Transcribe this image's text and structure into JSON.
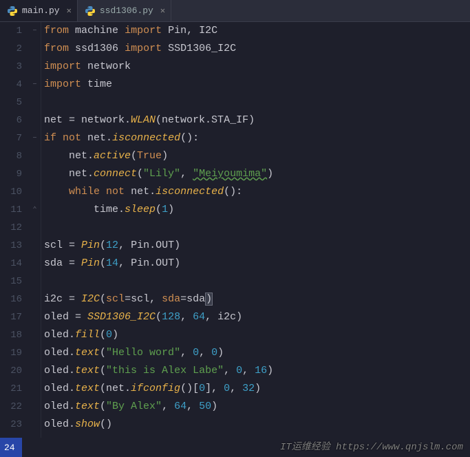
{
  "tabs": [
    {
      "name": "main.py",
      "active": true
    },
    {
      "name": "ssd1306.py",
      "active": false
    }
  ],
  "gutter_start": 1,
  "gutter_end": 23,
  "fold_markers": {
    "1": "−",
    "4": "−",
    "7": "−",
    "11": "⌃"
  },
  "code_lines": [
    [
      [
        "kw",
        "from"
      ],
      [
        "op",
        " "
      ],
      [
        "mod",
        "machine"
      ],
      [
        "op",
        " "
      ],
      [
        "kw",
        "import"
      ],
      [
        "op",
        " "
      ],
      [
        "cls",
        "Pin"
      ],
      [
        "op",
        ", "
      ],
      [
        "cls",
        "I2C"
      ]
    ],
    [
      [
        "kw",
        "from"
      ],
      [
        "op",
        " "
      ],
      [
        "mod",
        "ssd1306"
      ],
      [
        "op",
        " "
      ],
      [
        "kw",
        "import"
      ],
      [
        "op",
        " "
      ],
      [
        "cls",
        "SSD1306_I2C"
      ]
    ],
    [
      [
        "kw",
        "import"
      ],
      [
        "op",
        " "
      ],
      [
        "mod",
        "network"
      ]
    ],
    [
      [
        "kw",
        "import"
      ],
      [
        "op",
        " "
      ],
      [
        "mod",
        "time"
      ]
    ],
    [],
    [
      [
        "op",
        "net = network."
      ],
      [
        "fn",
        "WLAN"
      ],
      [
        "op",
        "(network.STA_IF)"
      ]
    ],
    [
      [
        "kw",
        "if"
      ],
      [
        "op",
        " "
      ],
      [
        "kw",
        "not"
      ],
      [
        "op",
        " net."
      ],
      [
        "fn",
        "isconnected"
      ],
      [
        "op",
        "():"
      ]
    ],
    [
      [
        "op",
        "    net."
      ],
      [
        "fn",
        "active"
      ],
      [
        "op",
        "("
      ],
      [
        "kw2",
        "True"
      ],
      [
        "op",
        ")"
      ]
    ],
    [
      [
        "op",
        "    net."
      ],
      [
        "fn",
        "connect"
      ],
      [
        "op",
        "("
      ],
      [
        "str",
        "\"Lily\""
      ],
      [
        "op",
        ", "
      ],
      [
        "str-u",
        "\"Meiyoumima\""
      ],
      [
        "op",
        ")"
      ]
    ],
    [
      [
        "op",
        "    "
      ],
      [
        "kw",
        "while"
      ],
      [
        "op",
        " "
      ],
      [
        "kw",
        "not"
      ],
      [
        "op",
        " net."
      ],
      [
        "fn",
        "isconnected"
      ],
      [
        "op",
        "():"
      ]
    ],
    [
      [
        "op",
        "        time."
      ],
      [
        "fn",
        "sleep"
      ],
      [
        "op",
        "("
      ],
      [
        "num",
        "1"
      ],
      [
        "op",
        ")"
      ]
    ],
    [],
    [
      [
        "op",
        "scl = "
      ],
      [
        "fn",
        "Pin"
      ],
      [
        "op",
        "("
      ],
      [
        "num",
        "12"
      ],
      [
        "op",
        ", Pin.OUT)"
      ]
    ],
    [
      [
        "op",
        "sda = "
      ],
      [
        "fn",
        "Pin"
      ],
      [
        "op",
        "("
      ],
      [
        "num",
        "14"
      ],
      [
        "op",
        ", Pin.OUT)"
      ]
    ],
    [],
    [
      [
        "op",
        "i2c = "
      ],
      [
        "fn",
        "I2C"
      ],
      [
        "op",
        "("
      ],
      [
        "kw2",
        "scl"
      ],
      [
        "op",
        "=scl, "
      ],
      [
        "kw2",
        "sda"
      ],
      [
        "op",
        "=sda"
      ],
      [
        "paren-hl",
        ")"
      ]
    ],
    [
      [
        "op",
        "oled = "
      ],
      [
        "fn",
        "SSD1306_I2C"
      ],
      [
        "op",
        "("
      ],
      [
        "num",
        "128"
      ],
      [
        "op",
        ", "
      ],
      [
        "num",
        "64"
      ],
      [
        "op",
        ", i2c)"
      ]
    ],
    [
      [
        "op",
        "oled."
      ],
      [
        "fn",
        "fill"
      ],
      [
        "op",
        "("
      ],
      [
        "num",
        "0"
      ],
      [
        "op",
        ")"
      ]
    ],
    [
      [
        "op",
        "oled."
      ],
      [
        "fn",
        "text"
      ],
      [
        "op",
        "("
      ],
      [
        "str",
        "\"Hello word\""
      ],
      [
        "op",
        ", "
      ],
      [
        "num",
        "0"
      ],
      [
        "op",
        ", "
      ],
      [
        "num",
        "0"
      ],
      [
        "op",
        ")"
      ]
    ],
    [
      [
        "op",
        "oled."
      ],
      [
        "fn",
        "text"
      ],
      [
        "op",
        "("
      ],
      [
        "str",
        "\"this is Alex Labe\""
      ],
      [
        "op",
        ", "
      ],
      [
        "num",
        "0"
      ],
      [
        "op",
        ", "
      ],
      [
        "num",
        "16"
      ],
      [
        "op",
        ")"
      ]
    ],
    [
      [
        "op",
        "oled."
      ],
      [
        "fn",
        "text"
      ],
      [
        "op",
        "(net."
      ],
      [
        "fn",
        "ifconfig"
      ],
      [
        "op",
        "()["
      ],
      [
        "num",
        "0"
      ],
      [
        "op",
        "], "
      ],
      [
        "num",
        "0"
      ],
      [
        "op",
        ", "
      ],
      [
        "num",
        "32"
      ],
      [
        "op",
        ")"
      ]
    ],
    [
      [
        "op",
        "oled."
      ],
      [
        "fn",
        "text"
      ],
      [
        "op",
        "("
      ],
      [
        "str",
        "\"By Alex\""
      ],
      [
        "op",
        ", "
      ],
      [
        "num",
        "64"
      ],
      [
        "op",
        ", "
      ],
      [
        "num",
        "50"
      ],
      [
        "op",
        ")"
      ]
    ],
    [
      [
        "op",
        "oled."
      ],
      [
        "fn",
        "show"
      ],
      [
        "op",
        "()"
      ]
    ]
  ],
  "status": {
    "line_col": "24"
  },
  "watermark": "IT运维经验 https://www.qnjslm.com"
}
